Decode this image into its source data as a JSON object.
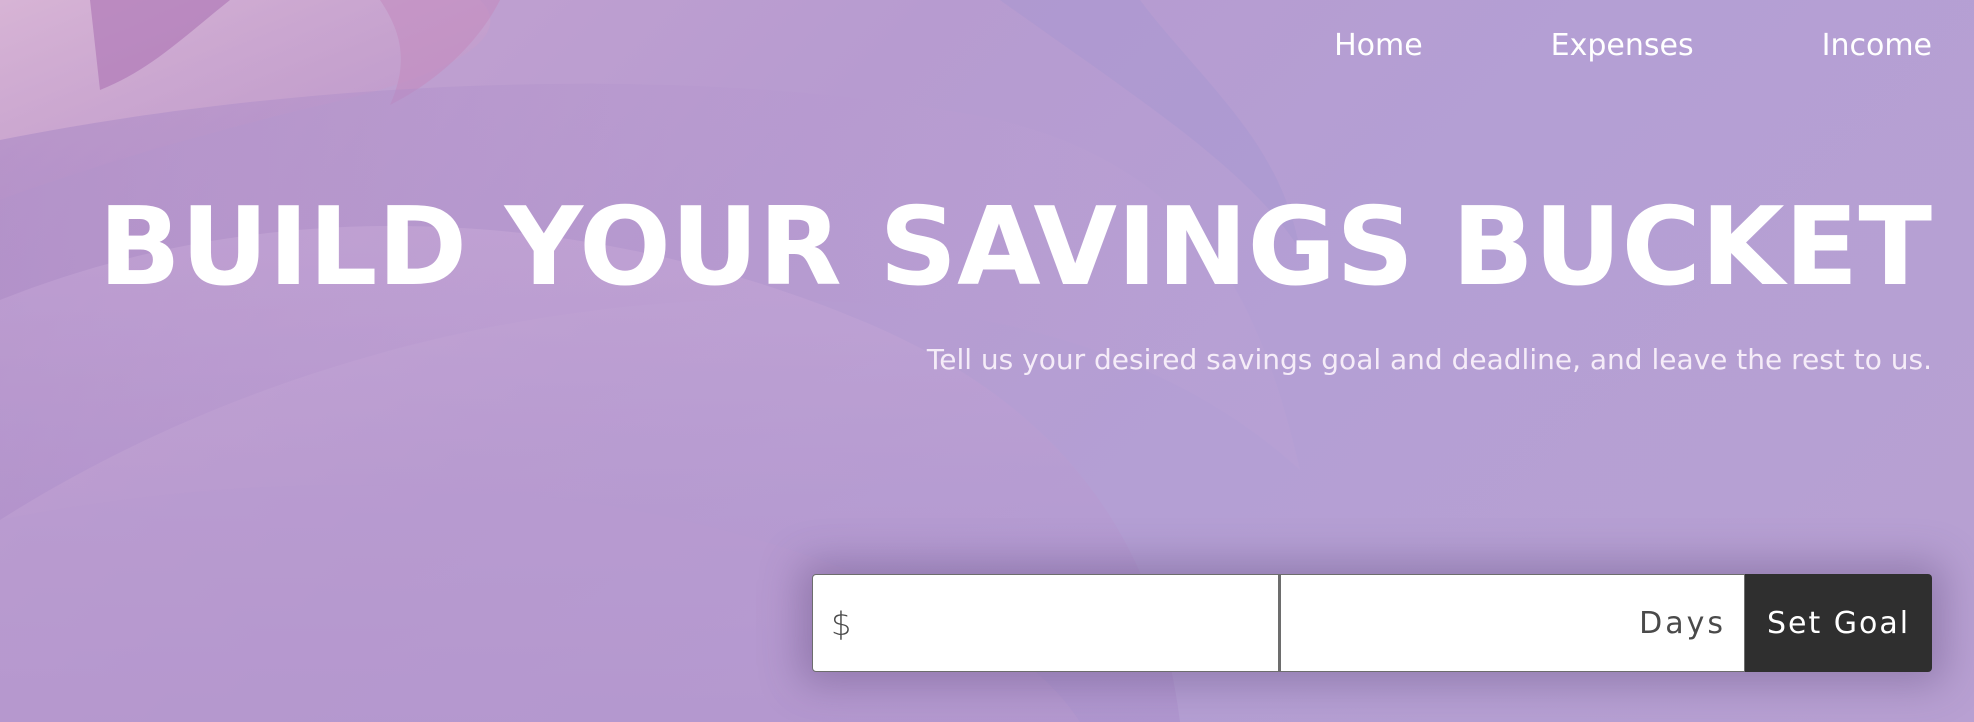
{
  "nav": {
    "items": [
      {
        "label": "Home"
      },
      {
        "label": "Expenses"
      },
      {
        "label": "Income"
      }
    ]
  },
  "hero": {
    "title": "BUILD YOUR SAVINGS BUCKET",
    "subtitle": "Tell us your desired savings goal and deadline, and leave the rest to us."
  },
  "form": {
    "amount_prefix": "$",
    "amount_value": "",
    "days_suffix": "Days",
    "days_value": "",
    "submit_label": "Set Goal"
  },
  "colors": {
    "background": "#b79bd0",
    "button": "#2f2f2f",
    "text": "#ffffff"
  }
}
